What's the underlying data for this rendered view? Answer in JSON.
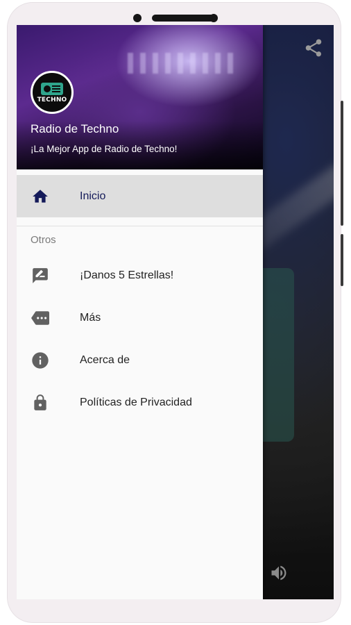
{
  "drawer": {
    "logo_text": "TECHNO",
    "title": "Radio de Techno",
    "subtitle": "¡La Mejor App de Radio de Techno!",
    "items": [
      {
        "label": "Inicio",
        "icon": "home-icon",
        "active": true
      }
    ],
    "section_label": "Otros",
    "other_items": [
      {
        "label": "¡Danos 5 Estrellas!",
        "icon": "rate-review-icon"
      },
      {
        "label": "Más",
        "icon": "more-tag-icon"
      },
      {
        "label": "Acerca de",
        "icon": "info-icon"
      },
      {
        "label": "Políticas de Privacidad",
        "icon": "lock-icon"
      }
    ]
  },
  "toolbar": {
    "share_icon": "share-icon"
  },
  "player": {
    "volume_icon": "volume-icon"
  },
  "colors": {
    "active_item_bg": "#dedede",
    "active_text": "#141a59",
    "icon_gray": "#616161",
    "drawer_bg": "#fafafa"
  }
}
